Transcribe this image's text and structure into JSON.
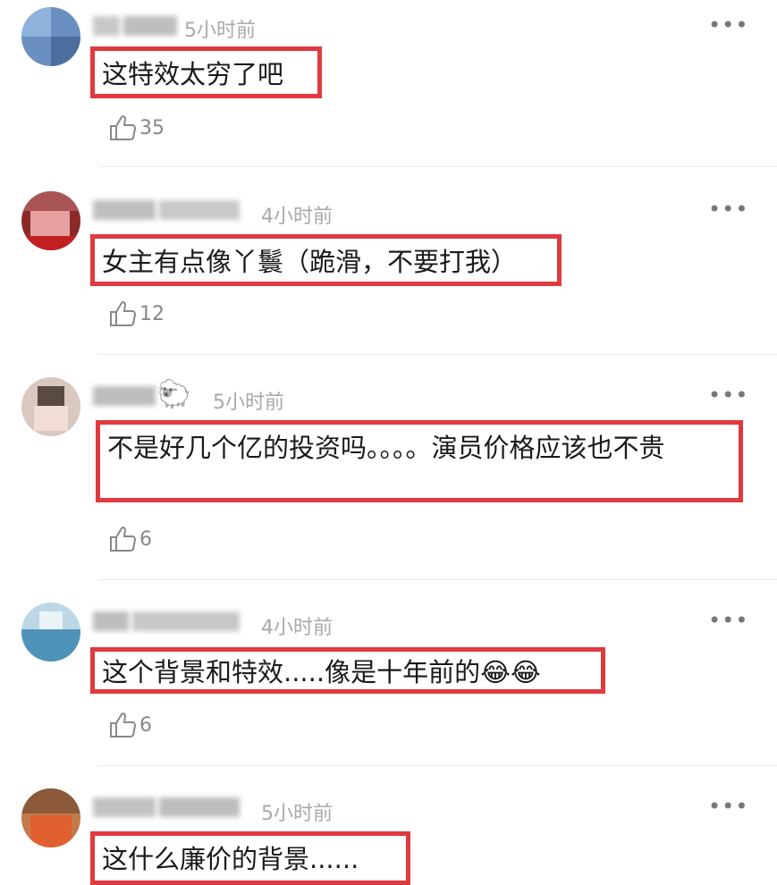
{
  "comments": [
    {
      "time": "5小时前",
      "text": "这特效太穷了吧",
      "likes": "35"
    },
    {
      "time": "4小时前",
      "text": "女主有点像丫鬟（跪滑，不要打我）",
      "likes": "12"
    },
    {
      "time": "5小时前",
      "text": "不是好几个亿的投资吗。。。。演员价格应该也不贵",
      "likes": "6"
    },
    {
      "time": "4小时前",
      "text": "这个背景和特效.....像是十年前的😂😂",
      "likes": "6"
    },
    {
      "time": "5小时前",
      "text": "这什么廉价的背景......",
      "likes": ""
    }
  ],
  "more_label": "•••",
  "colors": {
    "highlight_box": "#e03a3e",
    "time_text": "#a9a9a9",
    "divider": "#ececec"
  }
}
